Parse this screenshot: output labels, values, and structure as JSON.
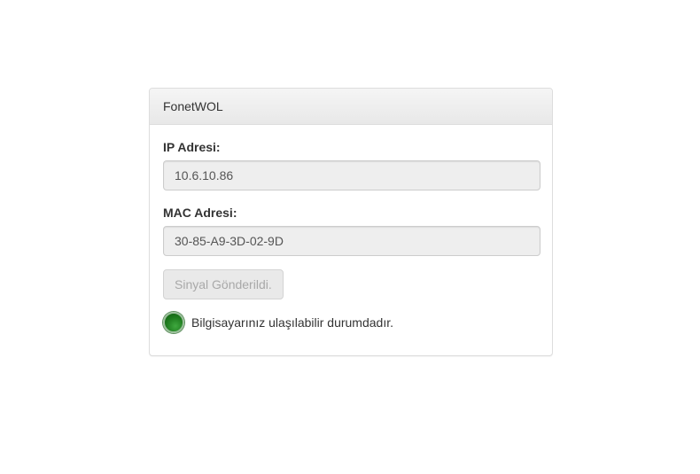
{
  "panel": {
    "title": "FonetWOL"
  },
  "form": {
    "ip_label": "IP Adresi:",
    "ip_value": "10.6.10.86",
    "mac_label": "MAC Adresi:",
    "mac_value": "30-85-A9-3D-02-9D",
    "button_label": "Sinyal Gönderildi."
  },
  "status": {
    "icon": "status-online-icon",
    "color": "#1d7a1d",
    "text": "Bilgisayarınız ulaşılabilir durumdadır."
  }
}
